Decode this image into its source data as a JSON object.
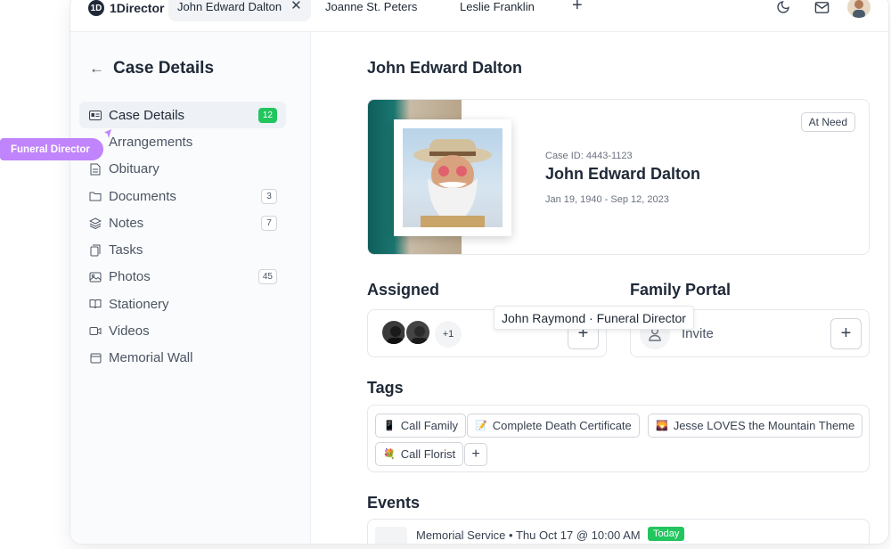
{
  "app": {
    "name": "1Director",
    "logo_glyph": "1D"
  },
  "tabs": [
    {
      "label": "John Edward Dalton",
      "active": true
    },
    {
      "label": "Joanne St. Peters",
      "active": false
    },
    {
      "label": "Leslie Franklin",
      "active": false
    }
  ],
  "topbar_icons": [
    "moon-icon",
    "mail-icon",
    "user-avatar"
  ],
  "sidebar": {
    "title": "Case Details",
    "items": [
      {
        "label": "Case Details",
        "icon": "id-card-icon",
        "badge": "12",
        "active": true
      },
      {
        "label": "Arrangements",
        "icon": "list-icon",
        "badge": ""
      },
      {
        "label": "Obituary",
        "icon": "document-icon",
        "badge": ""
      },
      {
        "label": "Documents",
        "icon": "folder-icon",
        "badge": "3"
      },
      {
        "label": "Notes",
        "icon": "layers-icon",
        "badge": "7"
      },
      {
        "label": "Tasks",
        "icon": "clipboard-icon",
        "badge": ""
      },
      {
        "label": "Photos",
        "icon": "image-icon",
        "badge": "45"
      },
      {
        "label": "Stationery",
        "icon": "book-icon",
        "badge": ""
      },
      {
        "label": "Videos",
        "icon": "video-icon",
        "badge": ""
      },
      {
        "label": "Memorial Wall",
        "icon": "window-icon",
        "badge": ""
      }
    ]
  },
  "main": {
    "title": "John Edward Dalton",
    "hero": {
      "status": "At Need",
      "case_id": "Case ID: 4443-1123",
      "name": "John Edward Dalton",
      "dates": "Jan 19, 1940 - Sep 12, 2023"
    },
    "assigned": {
      "heading": "Assigned",
      "more": "+1",
      "tooltip": "John Raymond · Funeral Director"
    },
    "family_portal": {
      "heading": "Family Portal",
      "invite": "Invite"
    },
    "tags": {
      "heading": "Tags",
      "items": [
        {
          "emoji": "📱",
          "label": "Call Family"
        },
        {
          "emoji": "📝",
          "label": "Complete Death Certificate"
        },
        {
          "emoji": "🌄",
          "label": "Jesse LOVES the Mountain Theme"
        },
        {
          "emoji": "💐",
          "label": "Call Florist"
        }
      ]
    },
    "events": {
      "heading": "Events",
      "first": {
        "text": "Memorial Service • Thu Oct 17 @ 10:00 AM",
        "badge": "Today"
      }
    }
  },
  "overlay": {
    "pill": "Funeral Director"
  },
  "colors": {
    "accent_green": "#22c55e",
    "pill_purple": "#c084fc",
    "text": "#1f2937"
  }
}
